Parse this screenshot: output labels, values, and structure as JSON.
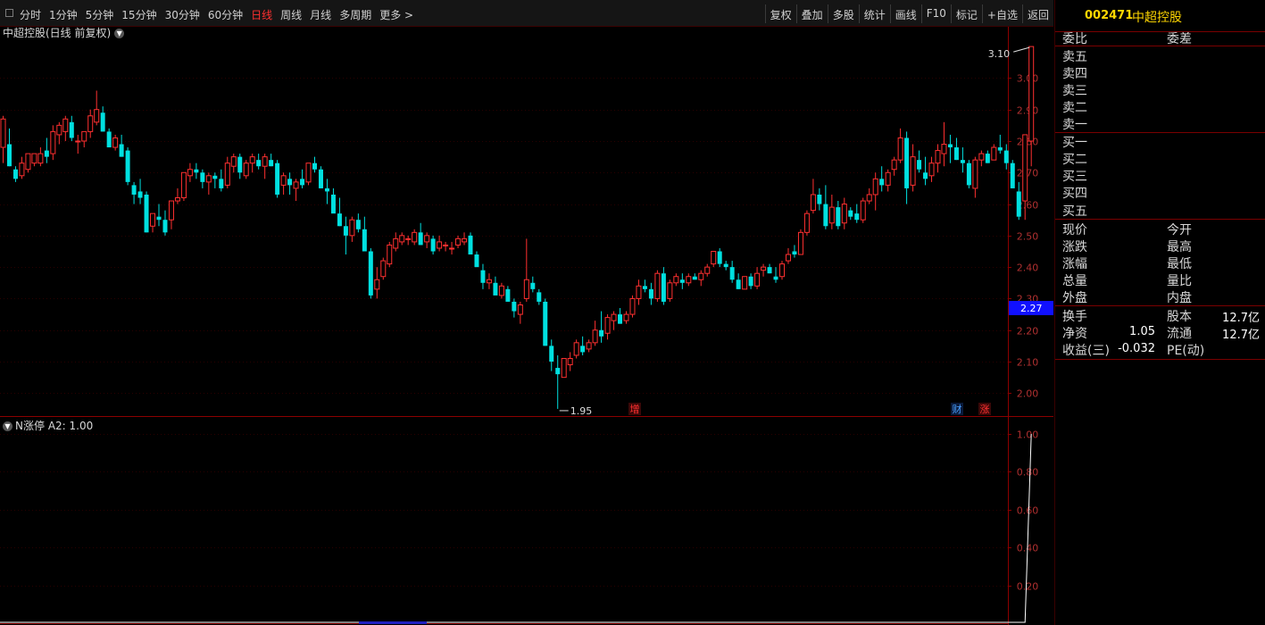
{
  "toolbar": {
    "periods": [
      "分时",
      "1分钟",
      "5分钟",
      "15分钟",
      "30分钟",
      "60分钟",
      "日线",
      "周线",
      "月线",
      "多周期",
      "更多 >"
    ],
    "active_period": "日线",
    "tools": [
      "复权",
      "叠加",
      "多股",
      "统计",
      "画线",
      "F10",
      "标记",
      "+自选",
      "返回"
    ]
  },
  "main_chart": {
    "title": "中超控股(日线 前复权)",
    "high_label": "3.10",
    "low_label": "1.95",
    "current_price_tag": "2.27",
    "y_ticks": [
      "3.00",
      "2.90",
      "2.80",
      "2.70",
      "2.60",
      "2.50",
      "2.40",
      "2.30",
      "2.20",
      "2.10",
      "2.00"
    ],
    "markers": [
      {
        "text": "增",
        "color": "#ff3030"
      },
      {
        "text": "财",
        "color": "#4aa0ff"
      },
      {
        "text": "涨",
        "color": "#ff3030"
      }
    ],
    "colors": {
      "up": "#ff3030",
      "down": "#00e0e0",
      "axis": "#8b0000"
    }
  },
  "sub_chart": {
    "title": "N涨停",
    "param": "A2: 1.00",
    "y_ticks": [
      "1.00",
      "0.80",
      "0.60",
      "0.40",
      "0.20"
    ]
  },
  "quote_panel": {
    "code": "002471",
    "name": "中超控股",
    "wei": {
      "left": "委比",
      "right": "委差"
    },
    "sell": [
      "卖五",
      "卖四",
      "卖三",
      "卖二",
      "卖一"
    ],
    "buy": [
      "买一",
      "买二",
      "买三",
      "买四",
      "买五"
    ],
    "stats": [
      {
        "l": "现价",
        "r": "今开"
      },
      {
        "l": "涨跌",
        "r": "最高"
      },
      {
        "l": "涨幅",
        "r": "最低"
      },
      {
        "l": "总量",
        "r": "量比"
      },
      {
        "l": "外盘",
        "r": "内盘"
      }
    ],
    "fin": [
      {
        "l": "换手",
        "lv": "",
        "r": "股本",
        "rv": "12.7亿"
      },
      {
        "l": "净资",
        "lv": "1.05",
        "r": "流通",
        "rv": "12.7亿"
      },
      {
        "l": "收益(三)",
        "lv": "-0.032",
        "r": "PE(动)",
        "rv": ""
      }
    ]
  },
  "chart_data": {
    "type": "candlestick",
    "ylim": [
      1.93,
      3.14
    ],
    "candles": [
      [
        2.78,
        2.88,
        2.73,
        2.87
      ],
      [
        2.79,
        2.84,
        2.72,
        2.72
      ],
      [
        2.71,
        2.72,
        2.67,
        2.68
      ],
      [
        2.69,
        2.75,
        2.68,
        2.73
      ],
      [
        2.71,
        2.76,
        2.7,
        2.76
      ],
      [
        2.73,
        2.76,
        2.72,
        2.76
      ],
      [
        2.73,
        2.78,
        2.72,
        2.76
      ],
      [
        2.77,
        2.81,
        2.73,
        2.75
      ],
      [
        2.76,
        2.85,
        2.74,
        2.83
      ],
      [
        2.82,
        2.86,
        2.79,
        2.85
      ],
      [
        2.83,
        2.88,
        2.8,
        2.87
      ],
      [
        2.86,
        2.88,
        2.8,
        2.81
      ],
      [
        2.8,
        2.82,
        2.76,
        2.8
      ],
      [
        2.8,
        2.83,
        2.78,
        2.83
      ],
      [
        2.83,
        2.9,
        2.81,
        2.88
      ],
      [
        2.86,
        2.96,
        2.85,
        2.9
      ],
      [
        2.89,
        2.91,
        2.83,
        2.83
      ],
      [
        2.83,
        2.84,
        2.78,
        2.78
      ],
      [
        2.78,
        2.82,
        2.77,
        2.81
      ],
      [
        2.79,
        2.82,
        2.75,
        2.75
      ],
      [
        2.77,
        2.78,
        2.66,
        2.67
      ],
      [
        2.66,
        2.67,
        2.6,
        2.63
      ],
      [
        2.64,
        2.68,
        2.6,
        2.62
      ],
      [
        2.63,
        2.64,
        2.51,
        2.51
      ],
      [
        2.53,
        2.57,
        2.51,
        2.57
      ],
      [
        2.56,
        2.6,
        2.53,
        2.55
      ],
      [
        2.55,
        2.58,
        2.5,
        2.51
      ],
      [
        2.55,
        2.61,
        2.52,
        2.61
      ],
      [
        2.61,
        2.65,
        2.6,
        2.62
      ],
      [
        2.62,
        2.7,
        2.61,
        2.7
      ],
      [
        2.69,
        2.73,
        2.67,
        2.71
      ],
      [
        2.71,
        2.73,
        2.68,
        2.7
      ],
      [
        2.7,
        2.71,
        2.65,
        2.67
      ],
      [
        2.67,
        2.7,
        2.63,
        2.69
      ],
      [
        2.69,
        2.7,
        2.65,
        2.68
      ],
      [
        2.68,
        2.71,
        2.64,
        2.65
      ],
      [
        2.66,
        2.75,
        2.65,
        2.73
      ],
      [
        2.72,
        2.76,
        2.7,
        2.75
      ],
      [
        2.75,
        2.76,
        2.68,
        2.7
      ],
      [
        2.69,
        2.74,
        2.68,
        2.73
      ],
      [
        2.73,
        2.76,
        2.7,
        2.75
      ],
      [
        2.74,
        2.76,
        2.71,
        2.72
      ],
      [
        2.72,
        2.76,
        2.68,
        2.75
      ],
      [
        2.74,
        2.76,
        2.72,
        2.72
      ],
      [
        2.73,
        2.74,
        2.62,
        2.63
      ],
      [
        2.66,
        2.7,
        2.63,
        2.69
      ],
      [
        2.68,
        2.7,
        2.63,
        2.66
      ],
      [
        2.65,
        2.68,
        2.61,
        2.67
      ],
      [
        2.68,
        2.71,
        2.65,
        2.66
      ],
      [
        2.67,
        2.73,
        2.66,
        2.73
      ],
      [
        2.73,
        2.75,
        2.7,
        2.71
      ],
      [
        2.71,
        2.72,
        2.65,
        2.65
      ],
      [
        2.65,
        2.68,
        2.6,
        2.64
      ],
      [
        2.63,
        2.65,
        2.59,
        2.57
      ],
      [
        2.57,
        2.62,
        2.53,
        2.53
      ],
      [
        2.53,
        2.56,
        2.44,
        2.5
      ],
      [
        2.5,
        2.56,
        2.48,
        2.55
      ],
      [
        2.55,
        2.57,
        2.51,
        2.52
      ],
      [
        2.52,
        2.56,
        2.47,
        2.45
      ],
      [
        2.45,
        2.46,
        2.3,
        2.31
      ],
      [
        2.33,
        2.4,
        2.3,
        2.36
      ],
      [
        2.37,
        2.43,
        2.36,
        2.42
      ],
      [
        2.41,
        2.48,
        2.4,
        2.47
      ],
      [
        2.46,
        2.51,
        2.45,
        2.49
      ],
      [
        2.48,
        2.51,
        2.47,
        2.5
      ],
      [
        2.49,
        2.5,
        2.47,
        2.49
      ],
      [
        2.48,
        2.52,
        2.47,
        2.51
      ],
      [
        2.51,
        2.54,
        2.47,
        2.47
      ],
      [
        2.48,
        2.51,
        2.46,
        2.5
      ],
      [
        2.49,
        2.5,
        2.44,
        2.45
      ],
      [
        2.46,
        2.5,
        2.45,
        2.48
      ],
      [
        2.47,
        2.48,
        2.45,
        2.47
      ],
      [
        2.46,
        2.48,
        2.44,
        2.46
      ],
      [
        2.47,
        2.5,
        2.46,
        2.49
      ],
      [
        2.48,
        2.51,
        2.47,
        2.49
      ],
      [
        2.5,
        2.51,
        2.44,
        2.44
      ],
      [
        2.44,
        2.45,
        2.4,
        2.4
      ],
      [
        2.39,
        2.41,
        2.33,
        2.35
      ],
      [
        2.35,
        2.38,
        2.33,
        2.36
      ],
      [
        2.35,
        2.37,
        2.32,
        2.31
      ],
      [
        2.31,
        2.35,
        2.3,
        2.34
      ],
      [
        2.33,
        2.34,
        2.29,
        2.29
      ],
      [
        2.29,
        2.3,
        2.24,
        2.26
      ],
      [
        2.25,
        2.29,
        2.22,
        2.28
      ],
      [
        2.3,
        2.49,
        2.29,
        2.36
      ],
      [
        2.35,
        2.37,
        2.32,
        2.33
      ],
      [
        2.32,
        2.33,
        2.28,
        2.29
      ],
      [
        2.29,
        2.3,
        2.15,
        2.15
      ],
      [
        2.15,
        2.17,
        2.07,
        2.1
      ],
      [
        2.08,
        2.12,
        1.95,
        2.06
      ],
      [
        2.05,
        2.11,
        2.05,
        2.11
      ],
      [
        2.09,
        2.13,
        2.07,
        2.11
      ],
      [
        2.12,
        2.17,
        2.11,
        2.16
      ],
      [
        2.15,
        2.18,
        2.12,
        2.13
      ],
      [
        2.14,
        2.17,
        2.13,
        2.16
      ],
      [
        2.16,
        2.23,
        2.15,
        2.2
      ],
      [
        2.2,
        2.26,
        2.16,
        2.18
      ],
      [
        2.19,
        2.25,
        2.17,
        2.24
      ],
      [
        2.23,
        2.26,
        2.2,
        2.25
      ],
      [
        2.25,
        2.27,
        2.22,
        2.22
      ],
      [
        2.23,
        2.26,
        2.22,
        2.25
      ],
      [
        2.25,
        2.31,
        2.24,
        2.3
      ],
      [
        2.3,
        2.36,
        2.28,
        2.34
      ],
      [
        2.34,
        2.36,
        2.32,
        2.33
      ],
      [
        2.33,
        2.35,
        2.28,
        2.3
      ],
      [
        2.3,
        2.39,
        2.29,
        2.38
      ],
      [
        2.38,
        2.4,
        2.28,
        2.29
      ],
      [
        2.3,
        2.36,
        2.29,
        2.35
      ],
      [
        2.35,
        2.38,
        2.34,
        2.37
      ],
      [
        2.36,
        2.38,
        2.33,
        2.35
      ],
      [
        2.35,
        2.38,
        2.34,
        2.37
      ],
      [
        2.37,
        2.38,
        2.36,
        2.36
      ],
      [
        2.36,
        2.39,
        2.34,
        2.38
      ],
      [
        2.38,
        2.41,
        2.37,
        2.4
      ],
      [
        2.41,
        2.45,
        2.4,
        2.45
      ],
      [
        2.45,
        2.46,
        2.4,
        2.41
      ],
      [
        2.41,
        2.42,
        2.39,
        2.4
      ],
      [
        2.4,
        2.42,
        2.35,
        2.36
      ],
      [
        2.36,
        2.38,
        2.33,
        2.33
      ],
      [
        2.33,
        2.37,
        2.33,
        2.37
      ],
      [
        2.37,
        2.38,
        2.33,
        2.34
      ],
      [
        2.34,
        2.4,
        2.33,
        2.38
      ],
      [
        2.39,
        2.41,
        2.37,
        2.4
      ],
      [
        2.4,
        2.41,
        2.38,
        2.38
      ],
      [
        2.37,
        2.4,
        2.35,
        2.36
      ],
      [
        2.37,
        2.42,
        2.36,
        2.41
      ],
      [
        2.42,
        2.46,
        2.41,
        2.44
      ],
      [
        2.45,
        2.47,
        2.43,
        2.44
      ],
      [
        2.44,
        2.52,
        2.44,
        2.51
      ],
      [
        2.51,
        2.58,
        2.5,
        2.57
      ],
      [
        2.58,
        2.68,
        2.57,
        2.63
      ],
      [
        2.63,
        2.65,
        2.58,
        2.6
      ],
      [
        2.6,
        2.66,
        2.52,
        2.53
      ],
      [
        2.54,
        2.63,
        2.52,
        2.59
      ],
      [
        2.59,
        2.61,
        2.52,
        2.53
      ],
      [
        2.54,
        2.62,
        2.52,
        2.6
      ],
      [
        2.58,
        2.59,
        2.55,
        2.56
      ],
      [
        2.57,
        2.6,
        2.54,
        2.55
      ],
      [
        2.55,
        2.62,
        2.54,
        2.61
      ],
      [
        2.61,
        2.65,
        2.6,
        2.63
      ],
      [
        2.63,
        2.7,
        2.58,
        2.68
      ],
      [
        2.68,
        2.72,
        2.64,
        2.66
      ],
      [
        2.66,
        2.71,
        2.64,
        2.7
      ],
      [
        2.71,
        2.75,
        2.69,
        2.74
      ],
      [
        2.74,
        2.84,
        2.73,
        2.81
      ],
      [
        2.81,
        2.83,
        2.6,
        2.65
      ],
      [
        2.66,
        2.79,
        2.64,
        2.75
      ],
      [
        2.74,
        2.77,
        2.7,
        2.71
      ],
      [
        2.7,
        2.75,
        2.66,
        2.68
      ],
      [
        2.69,
        2.75,
        2.67,
        2.73
      ],
      [
        2.73,
        2.79,
        2.7,
        2.77
      ],
      [
        2.76,
        2.86,
        2.72,
        2.79
      ],
      [
        2.79,
        2.82,
        2.73,
        2.78
      ],
      [
        2.78,
        2.81,
        2.74,
        2.74
      ],
      [
        2.74,
        2.78,
        2.7,
        2.73
      ],
      [
        2.73,
        2.74,
        2.65,
        2.66
      ],
      [
        2.65,
        2.75,
        2.62,
        2.74
      ],
      [
        2.74,
        2.77,
        2.72,
        2.76
      ],
      [
        2.76,
        2.77,
        2.73,
        2.73
      ],
      [
        2.74,
        2.79,
        2.74,
        2.78
      ],
      [
        2.78,
        2.82,
        2.76,
        2.77
      ],
      [
        2.77,
        2.79,
        2.71,
        2.73
      ],
      [
        2.73,
        2.74,
        2.65,
        2.65
      ],
      [
        2.64,
        2.67,
        2.55,
        2.56
      ],
      [
        2.61,
        2.82,
        2.55,
        2.82
      ],
      [
        2.8,
        3.1,
        2.72,
        3.1
      ]
    ]
  }
}
